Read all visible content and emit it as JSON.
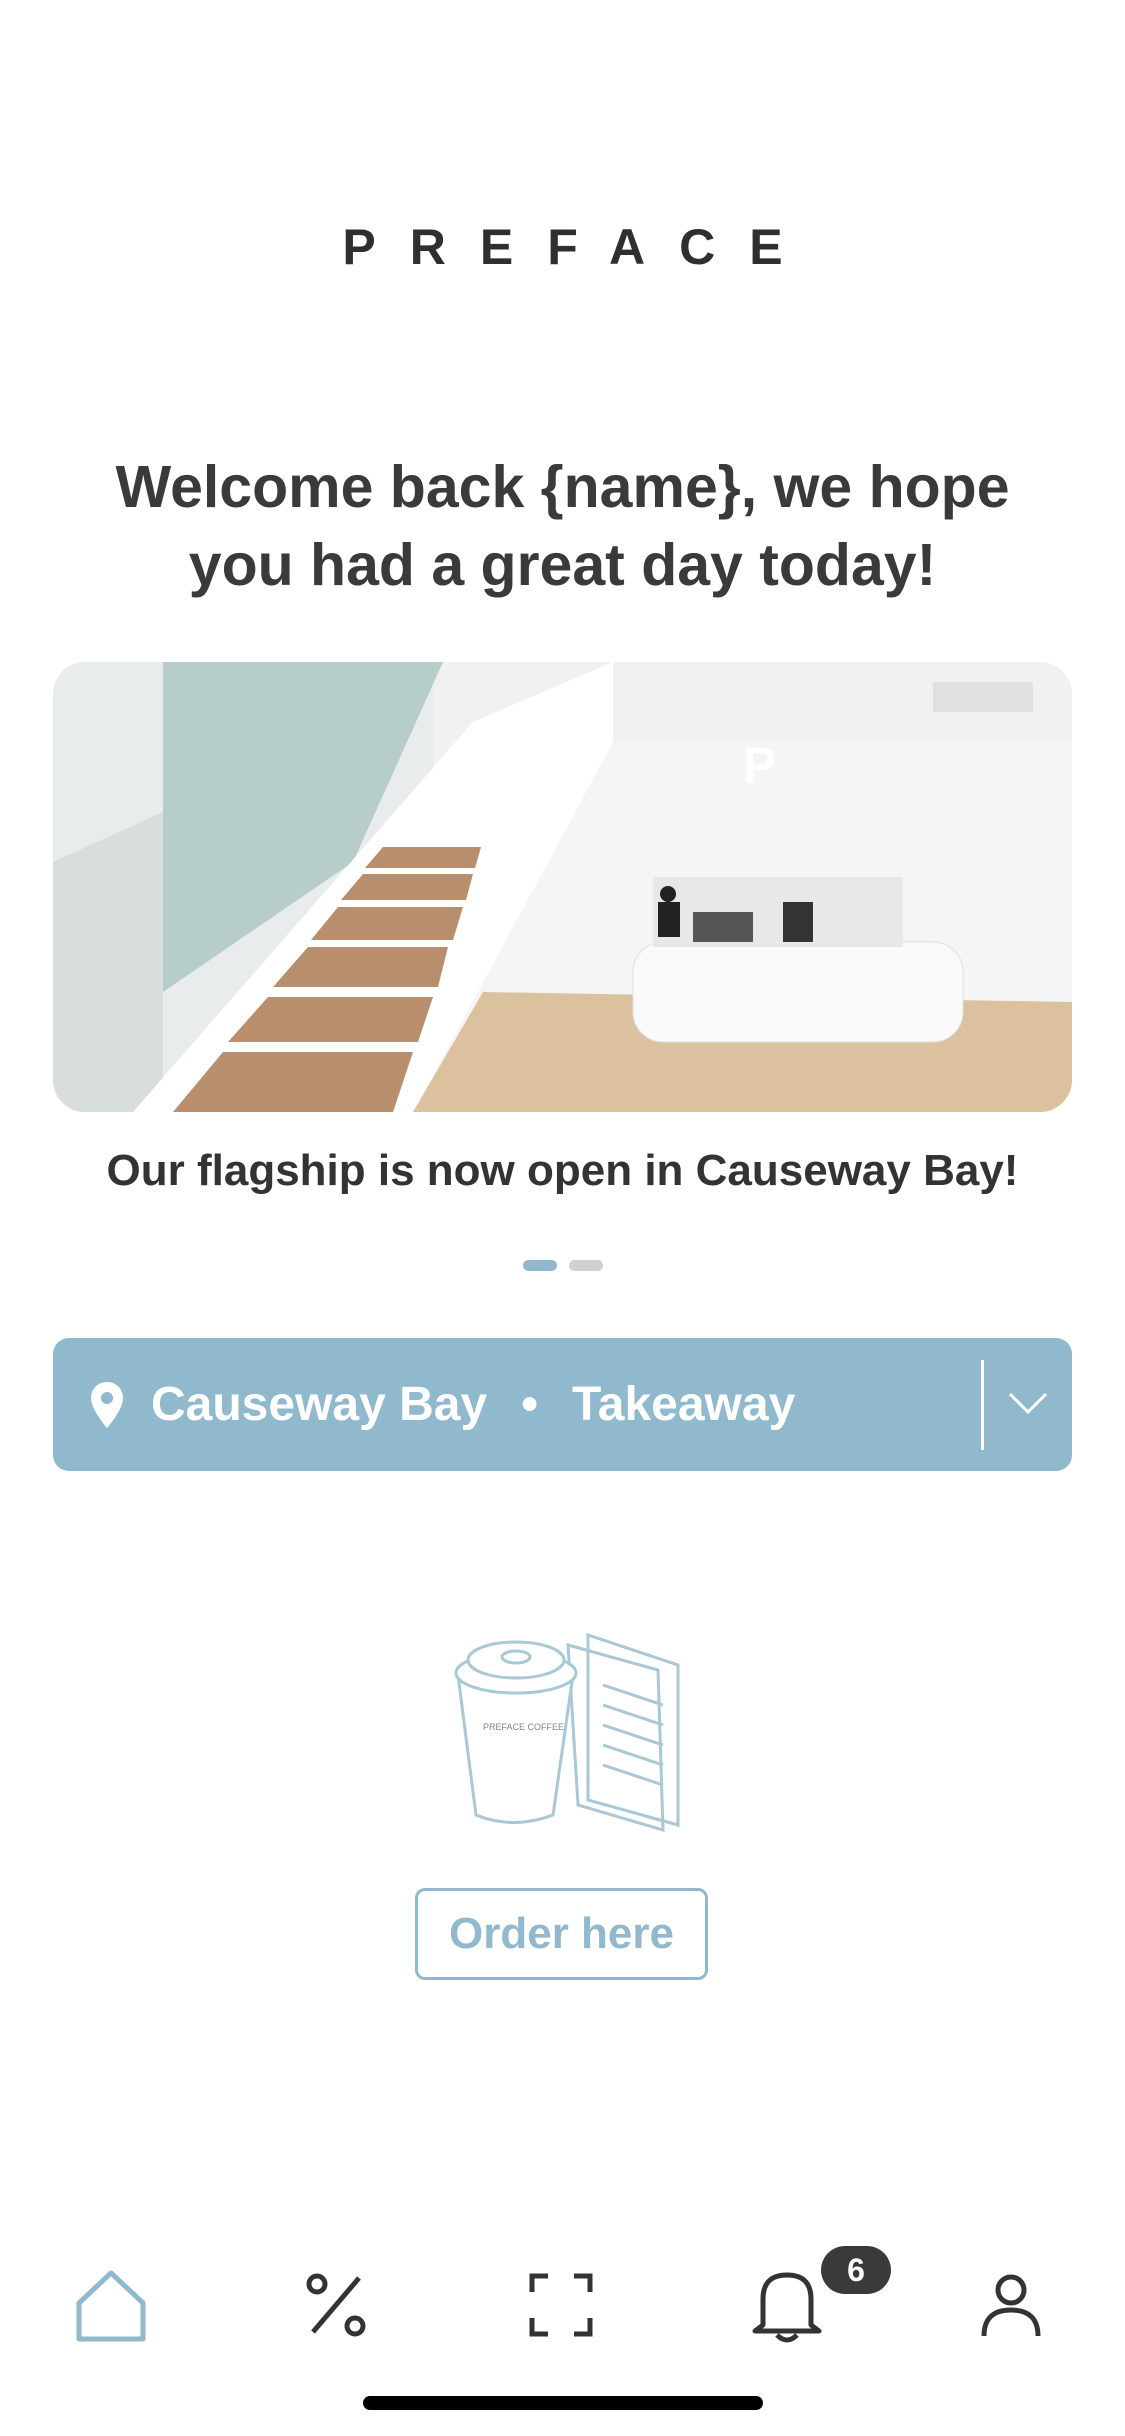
{
  "brand": {
    "logo_text": "PREFACE"
  },
  "welcome": {
    "text": "Welcome back {name}, we hope you had a great day today!"
  },
  "banner": {
    "caption": "Our flagship is now open in Causeway Bay!",
    "slides_count": 2,
    "active_slide": 1
  },
  "location_bar": {
    "location": "Causeway Bay",
    "separator": "•",
    "mode": "Takeaway",
    "icon": "location-pin-icon",
    "dropdown_icon": "chevron-down-icon"
  },
  "order": {
    "button_label": "Order here",
    "illustration": "coffee-cup-menu-illustration"
  },
  "tabbar": {
    "items": [
      {
        "name": "home",
        "icon": "home-icon",
        "active": true
      },
      {
        "name": "offers",
        "icon": "percent-icon",
        "active": false
      },
      {
        "name": "scan",
        "icon": "scan-icon",
        "active": false
      },
      {
        "name": "notifications",
        "icon": "bell-icon",
        "active": false,
        "badge": "6"
      },
      {
        "name": "profile",
        "icon": "user-icon",
        "active": false
      }
    ]
  },
  "colors": {
    "accent": "#90b9cd",
    "text_dark": "#333333",
    "badge_bg": "#3a3a3a"
  }
}
